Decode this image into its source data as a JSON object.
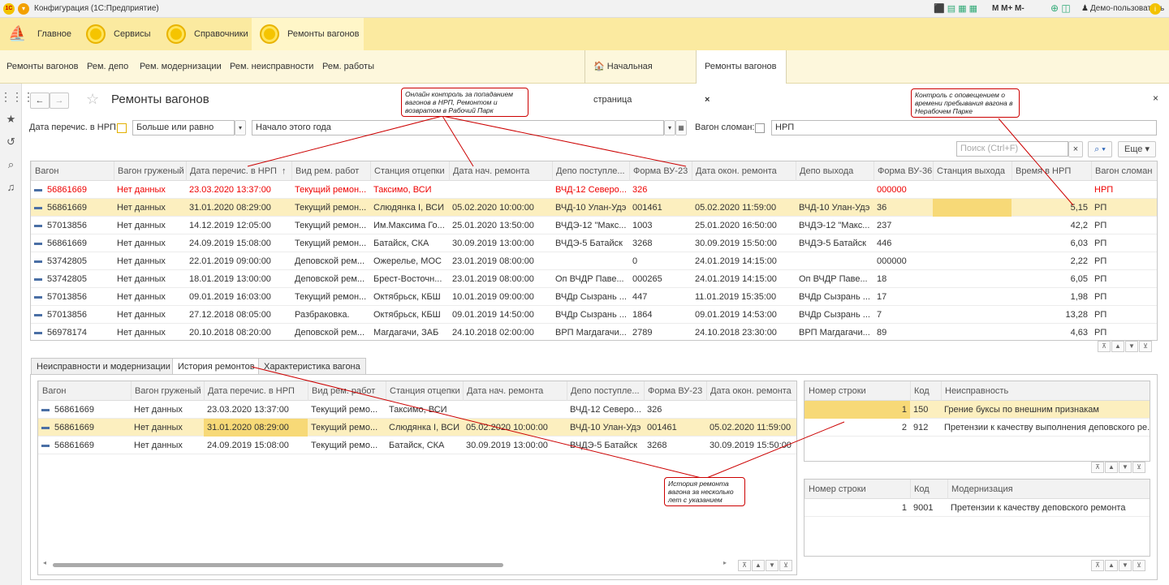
{
  "window": {
    "title": "Конфигурация  (1С:Предприятие)",
    "user": "Демо-пользователь",
    "toolbar_text": "M  M+  M-"
  },
  "sections": [
    {
      "label": "Главное"
    },
    {
      "label": "Сервисы"
    },
    {
      "label": "Справочники"
    },
    {
      "label": "Ремонты вагонов"
    }
  ],
  "subnav": [
    "Ремонты вагонов",
    "Рем. депо",
    "Рем. модернизации",
    "Рем. неисправности",
    "Рем. работы"
  ],
  "open_tabs": {
    "home": "Начальная страница",
    "current": "Ремонты вагонов"
  },
  "form": {
    "title": "Ремонты вагонов"
  },
  "filters": {
    "date_label": "Дата перечис. в НРП:",
    "cond": "Больше или равно",
    "period": "Начало этого года",
    "broken_label": "Вагон сломан:",
    "npr": "НРП"
  },
  "search": {
    "placeholder": "Поиск (Ctrl+F)",
    "more": "Еще"
  },
  "main_table": {
    "headers": [
      "Вагон",
      "Вагон груженый",
      "Дата перечис. в НРП",
      "Вид рем. работ",
      "Станция отцепки",
      "Дата нач. ремонта",
      "Депо поступле...",
      "Форма ВУ-23",
      "Дата окон. ремонта",
      "Депо выхода",
      "Форма ВУ-36",
      "Станция выхода",
      "Время в НРП",
      "Вагон сломан"
    ],
    "sort_mark": "↑",
    "rows": [
      [
        "56861669",
        "Нет данных",
        "23.03.2020 13:37:00",
        "Текущий ремон...",
        "Таксимо, ВСИ",
        "",
        "ВЧД-12 Северо...",
        "326",
        "",
        "",
        "000000",
        "",
        "",
        "НРП"
      ],
      [
        "56861669",
        "Нет данных",
        "31.01.2020 08:29:00",
        "Текущий ремон...",
        "Слюдянка I, ВСИ",
        "05.02.2020 10:00:00",
        "ВЧД-10 Улан-Удэ",
        "001461",
        "05.02.2020 11:59:00",
        "ВЧД-10 Улан-Удэ",
        "36",
        "",
        "5,15",
        "РП"
      ],
      [
        "57013856",
        "Нет данных",
        "14.12.2019 12:05:00",
        "Текущий ремон...",
        "Им.Максима Го...",
        "25.01.2020 13:50:00",
        "ВЧДЭ-12 \"Макс...",
        "1003",
        "25.01.2020 16:50:00",
        "ВЧДЭ-12 \"Макс...",
        "237",
        "",
        "42,2",
        "РП"
      ],
      [
        "56861669",
        "Нет данных",
        "24.09.2019 15:08:00",
        "Текущий ремон...",
        "Батайск, СКА",
        "30.09.2019 13:00:00",
        "ВЧДЭ-5 Батайск",
        "3268",
        "30.09.2019 15:50:00",
        "ВЧДЭ-5 Батайск",
        "446",
        "",
        "6,03",
        "РП"
      ],
      [
        "53742805",
        "Нет данных",
        "22.01.2019 09:00:00",
        "Деповской рем...",
        "Ожерелье, МОС",
        "23.01.2019 08:00:00",
        "",
        "0",
        "24.01.2019 14:15:00",
        "",
        "000000",
        "",
        "2,22",
        "РП"
      ],
      [
        "53742805",
        "Нет данных",
        "18.01.2019 13:00:00",
        "Деповской рем...",
        "Брест-Восточн...",
        "23.01.2019 08:00:00",
        "Оп ВЧДР Паве...",
        "000265",
        "24.01.2019 14:15:00",
        "Оп ВЧДР Паве...",
        "18",
        "",
        "6,05",
        "РП"
      ],
      [
        "57013856",
        "Нет данных",
        "09.01.2019 16:03:00",
        "Текущий ремон...",
        "Октябрьск, КБШ",
        "10.01.2019 09:00:00",
        "ВЧДр Сызрань ...",
        "447",
        "11.01.2019 15:35:00",
        "ВЧДр Сызрань ...",
        "17",
        "",
        "1,98",
        "РП"
      ],
      [
        "57013856",
        "Нет данных",
        "27.12.2018 08:05:00",
        "Разбраковка.",
        "Октябрьск, КБШ",
        "09.01.2019 14:50:00",
        "ВЧДр Сызрань ...",
        "1864",
        "09.01.2019 14:53:00",
        "ВЧДр Сызрань ...",
        "7",
        "",
        "13,28",
        "РП"
      ],
      [
        "56978174",
        "Нет данных",
        "20.10.2018 08:20:00",
        "Деповской рем...",
        "Магдагачи, ЗАБ",
        "24.10.2018 02:00:00",
        "ВРП Магдагачи...",
        "2789",
        "24.10.2018 23:30:00",
        "ВРП Магдагачи...",
        "89",
        "",
        "4,63",
        "РП"
      ]
    ]
  },
  "bottom_tabs": [
    "Неисправности и модернизации",
    "История ремонтов",
    "Характеристика вагона"
  ],
  "history_table": {
    "headers": [
      "Вагон",
      "Вагон груженый",
      "Дата перечис. в НРП",
      "Вид рем. работ",
      "Станция отцепки",
      "Дата нач. ремонта",
      "Депо поступле...",
      "Форма ВУ-23",
      "Дата окон. ремонта"
    ],
    "rows": [
      [
        "56861669",
        "Нет данных",
        "23.03.2020 13:37:00",
        "Текущий ремо...",
        "Таксимо, ВСИ",
        "",
        "ВЧД-12 Северо...",
        "326",
        ""
      ],
      [
        "56861669",
        "Нет данных",
        "31.01.2020 08:29:00",
        "Текущий ремо...",
        "Слюдянка I, ВСИ",
        "05.02.2020 10:00:00",
        "ВЧД-10 Улан-Удэ",
        "001461",
        "05.02.2020 11:59:00"
      ],
      [
        "56861669",
        "Нет данных",
        "24.09.2019 15:08:00",
        "Текущий ремо...",
        "Батайск, СКА",
        "30.09.2019 13:00:00",
        "ВЧДЭ-5 Батайск",
        "3268",
        "30.09.2019 15:50:00"
      ]
    ]
  },
  "faults_table": {
    "headers": [
      "Номер строки",
      "Код",
      "Неисправность"
    ],
    "rows": [
      [
        "1",
        "150",
        "Грение буксы по внешним признакам"
      ],
      [
        "2",
        "912",
        "Претензии к качеству выполнения деповского ре..."
      ]
    ]
  },
  "mods_table": {
    "headers": [
      "Номер строки",
      "Код",
      "Модернизация"
    ],
    "rows": [
      [
        "1",
        "9001",
        "Претензии к качеству деповского ремонта"
      ]
    ]
  },
  "callouts": {
    "c1": "Онлайн контроль за попаданием вагонов в НРП, Ремонтом и возвратом в Рабочий Парк",
    "c2": "Контроль с оповещением о времени пребывания вагона в Нерабочем Парке",
    "c3": "История ремонта вагона за несколько лет с указанием"
  },
  "colors": {
    "accent": "#fbeaa0",
    "selected_row": "#fcefbf",
    "red_text": "#e00000",
    "callout_line": "#cc0000"
  }
}
